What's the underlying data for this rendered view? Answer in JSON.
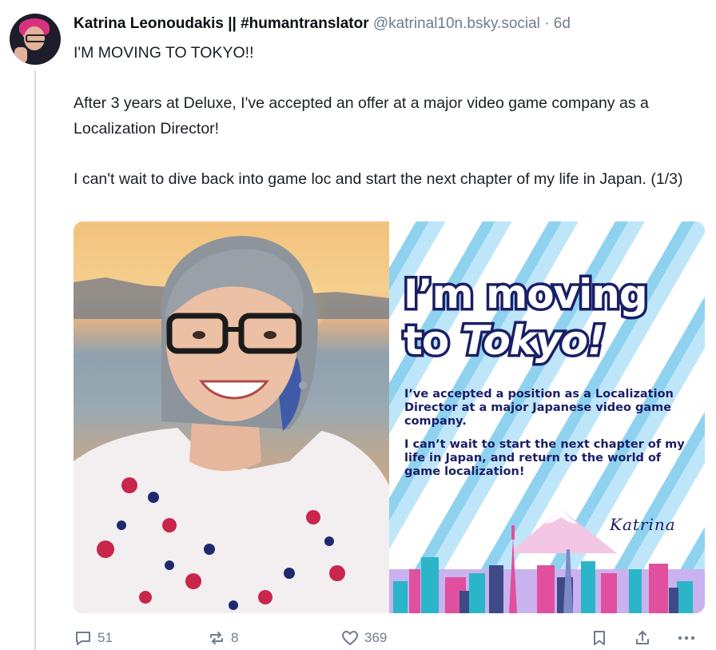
{
  "post": {
    "author": {
      "display_name": "Katrina Leonoudakis || #humantranslator",
      "handle": "@katrinal10n.bsky.social",
      "separator": "·",
      "time": "6d"
    },
    "text": {
      "line1": "I'M MOVING TO TOKYO!!",
      "para2": "After 3 years at Deluxe, I've accepted an offer at a major video game company as a Localization Director!",
      "para3": "I can't wait to dive back into game loc and start the next chapter of my life in Japan. (1/3)"
    },
    "image_card": {
      "title_line1": "I’m moving",
      "title_line2_prefix": "to ",
      "title_line2_emph": "Tokyo!",
      "body1": "I’ve accepted a position as a Localization Director at a major Japanese video game company.",
      "body2": "I can’t wait to start the next chapter of my life in Japan, and return to the world of game localization!",
      "signature": "Katrina"
    },
    "actions": {
      "reply_count": "51",
      "repost_count": "8",
      "like_count": "369"
    }
  },
  "icons": {
    "reply": "speech-bubble-icon",
    "repost": "repost-arrows-icon",
    "like": "heart-icon",
    "bookmark": "bookmark-icon",
    "share": "share-upload-icon",
    "more": "ellipsis-icon"
  },
  "colors": {
    "text_primary": "#0b0f14",
    "text_secondary": "#6f7d8c",
    "card_navy": "#1a1e66",
    "card_stripe": "#8fd2f0"
  }
}
